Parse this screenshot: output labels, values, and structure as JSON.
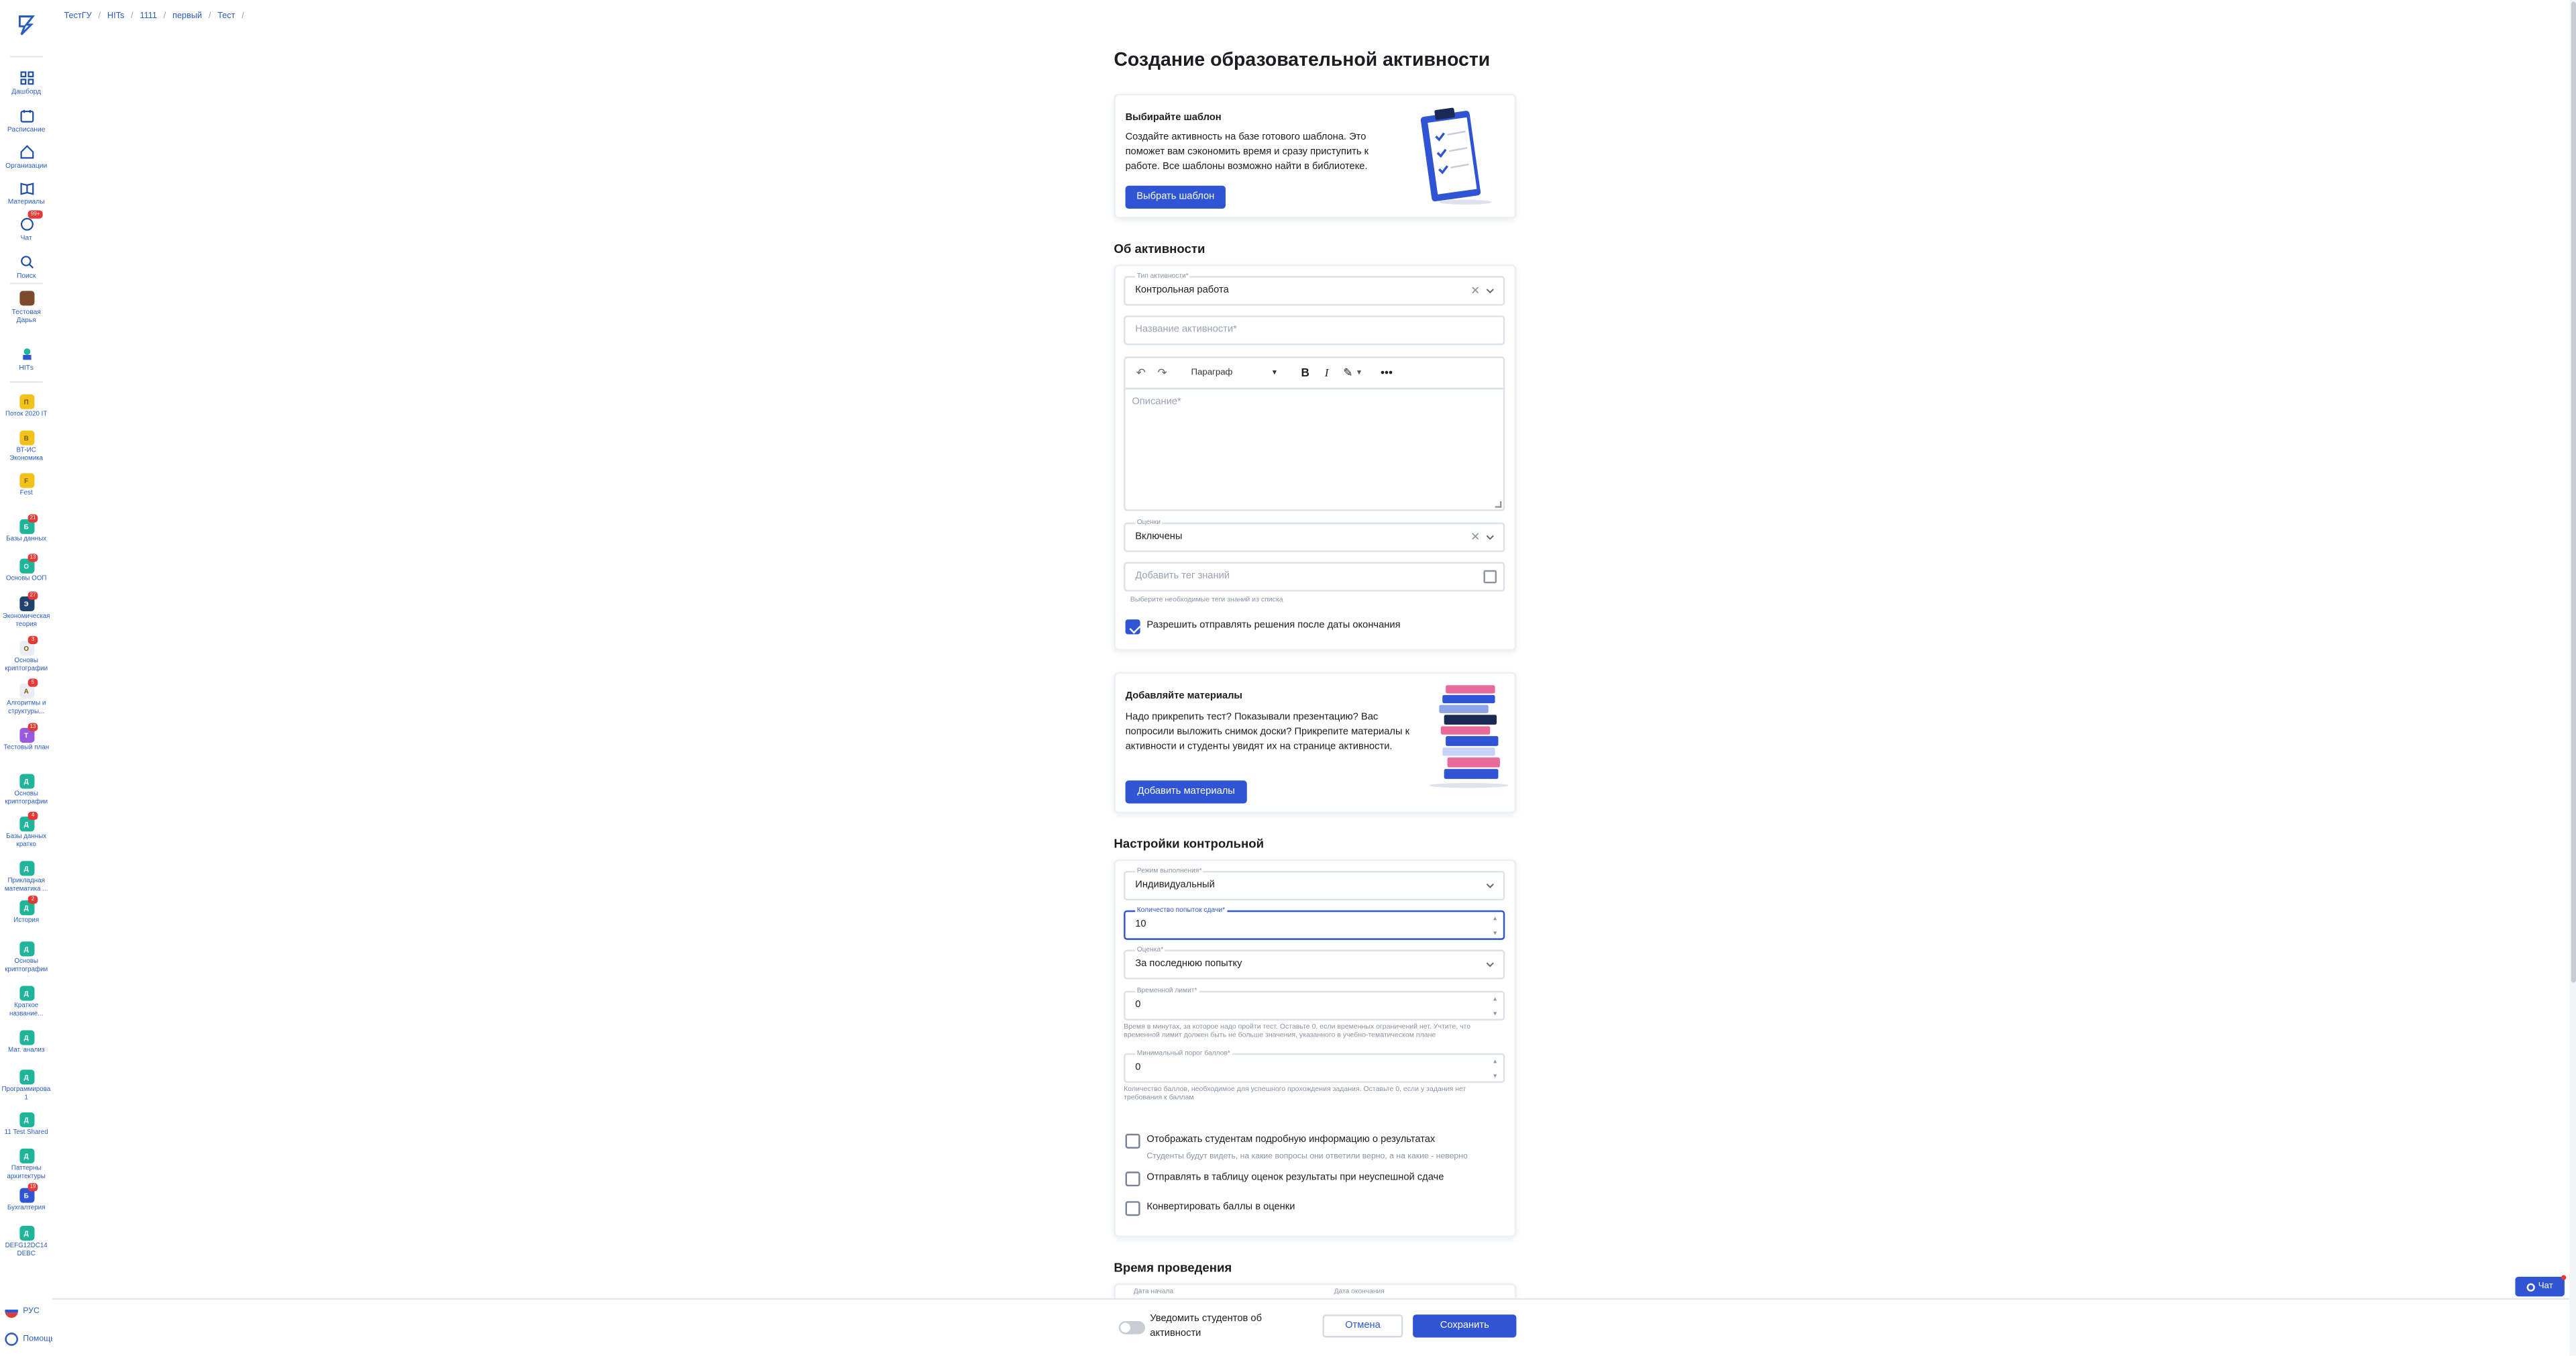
{
  "sidebar": {
    "nav": [
      {
        "label": "Дашборд",
        "icon": "dashboard-icon"
      },
      {
        "label": "Расписание",
        "icon": "calendar-icon"
      },
      {
        "label": "Организации",
        "icon": "home-icon"
      },
      {
        "label": "Материалы",
        "icon": "book-icon"
      },
      {
        "label": "Чат",
        "icon": "chat-icon",
        "badge": "99+"
      },
      {
        "label": "Поиск",
        "icon": "search-icon"
      }
    ],
    "profile_label": "Тестовая Дарья",
    "hits_label": "НІТs",
    "courses": [
      {
        "label": "Поток 2020 IT",
        "color": "#f2c21b",
        "letter": "П",
        "badge": ""
      },
      {
        "label": "ВТ-ИС Экономика",
        "color": "#f2c21b",
        "letter": "В",
        "badge": ""
      },
      {
        "label": "Fest",
        "color": "#f2c21b",
        "letter": "F",
        "badge": ""
      },
      {
        "label": "Базы данных",
        "color": "#1fb59a",
        "letter": "Б",
        "badge": "21"
      },
      {
        "label": "Основы ООП",
        "color": "#1fb59a",
        "letter": "О",
        "badge": "13"
      },
      {
        "label": "Экономическая теория",
        "color": "#20426e",
        "letter": "Э",
        "badge": "27"
      },
      {
        "label": "Основы криптографии",
        "color": "#e9eef6",
        "letter": "О",
        "badge": "3"
      },
      {
        "label": "Алгоритмы и структуры...",
        "color": "#e9eef6",
        "letter": "А",
        "badge": "5"
      },
      {
        "label": "Тестовый план",
        "color": "#9a5ae0",
        "letter": "Т",
        "badge": "13"
      },
      {
        "label": "Основы криптографии",
        "color": "#1fb59a",
        "letter": "Д",
        "badge": ""
      },
      {
        "label": "Базы данных кратко",
        "color": "#1fb59a",
        "letter": "Д",
        "badge": "4"
      },
      {
        "label": "Прикладная математика ...",
        "color": "#1fb59a",
        "letter": "Д",
        "badge": ""
      },
      {
        "label": "История",
        "color": "#1fb59a",
        "letter": "Д",
        "badge": "2"
      },
      {
        "label": "Основы криптографии",
        "color": "#1fb59a",
        "letter": "Д",
        "badge": ""
      },
      {
        "label": "Краткое название...",
        "color": "#1fb59a",
        "letter": "Д",
        "badge": ""
      },
      {
        "label": "Мат. анализ",
        "color": "#1fb59a",
        "letter": "Д",
        "badge": ""
      },
      {
        "label": "Программирование 1",
        "color": "#1fb59a",
        "letter": "Д",
        "badge": ""
      },
      {
        "label": "11 Test Shared",
        "color": "#1fb59a",
        "letter": "Д",
        "badge": ""
      },
      {
        "label": "Паттерны архитектуры",
        "color": "#1fb59a",
        "letter": "Д",
        "badge": ""
      },
      {
        "label": "Бухгалтерия",
        "color": "#2f55d4",
        "letter": "Б",
        "badge": "19"
      },
      {
        "label": "DEFG12DC14 DEBC",
        "color": "#1fb59a",
        "letter": "Д",
        "badge": ""
      }
    ],
    "language": "РУС",
    "help": "Помощь"
  },
  "breadcrumb": [
    "ТестГУ",
    "HITs",
    "1111",
    "первый",
    "Тест"
  ],
  "page_title": "Создание образовательной активности",
  "template_card": {
    "title": "Выбирайте шаблон",
    "text": "Создайте активность на базе готового шаблона. Это поможет вам сэкономить время и сразу приступить к работе. Все шаблоны возможно найти в библиотеке.",
    "button": "Выбрать шаблон"
  },
  "about": {
    "section_title": "Об активности",
    "type_label": "Тип активности*",
    "type_value": "Контрольная работа",
    "name_placeholder": "Название активности*",
    "editor": {
      "paragraph": "Параграф",
      "placeholder": "Описание*"
    },
    "grades_label": "Оценки",
    "grades_value": "Включены",
    "tag_placeholder": "Добавить тег знаний",
    "tag_hint": "Выберите необходимые теги знаний из списка",
    "late_submit_label": "Разрешить отправлять решения после даты окончания",
    "late_submit_checked": true
  },
  "materials_card": {
    "title": "Добавляйте материалы",
    "text": "Надо прикрепить тест? Показывали презентацию? Вас попросили выложить снимок доски? Прикрепите материалы к активности и студенты увидят их на странице активности.",
    "button": "Добавить материалы"
  },
  "settings": {
    "section_title": "Настройки контрольной",
    "mode_label": "Режим выполнения*",
    "mode_value": "Индивидуальный",
    "attempts_label": "Количество попыток сдачи*",
    "attempts_value": "10",
    "grade_label": "Оценка*",
    "grade_value": "За последнюю попытку",
    "time_limit_label": "Временной лимит*",
    "time_limit_value": "0",
    "time_limit_hint": "Время в минутах, за которое надо пройти тест. Оставьте 0, если временных ограничений нет. Учтите, что временной лимит должен быть не больше значения, указанного в учебно-тематическом плане",
    "min_score_label": "Минимальный порог баллов*",
    "min_score_value": "0",
    "min_score_hint": "Количество баллов, необходимое для успешного прохождения задания. Оставьте 0, если у задания нет требования к баллам",
    "checks": [
      {
        "label": "Отображать студентам подробную информацию о результатах",
        "sub": "Студенты будут видеть, на какие вопросы они ответили верно, а на какие - неверно",
        "checked": false
      },
      {
        "label": "Отправлять в таблицу оценок результаты при неуспешной сдаче",
        "sub": "",
        "checked": false
      },
      {
        "label": "Конвертировать баллы в оценки",
        "sub": "",
        "checked": false
      }
    ]
  },
  "time": {
    "section_title": "Время проведения",
    "start_label": "Дата начала",
    "end_label": "Дата окончания"
  },
  "footer": {
    "notify": "Уведомить студентов об активности",
    "notify_on": false,
    "cancel": "Отмена",
    "save": "Сохранить"
  },
  "chat_button": "Чат",
  "colors": {
    "accent": "#2f55d4",
    "link": "#2a5cc7",
    "badge": "#e53935"
  }
}
